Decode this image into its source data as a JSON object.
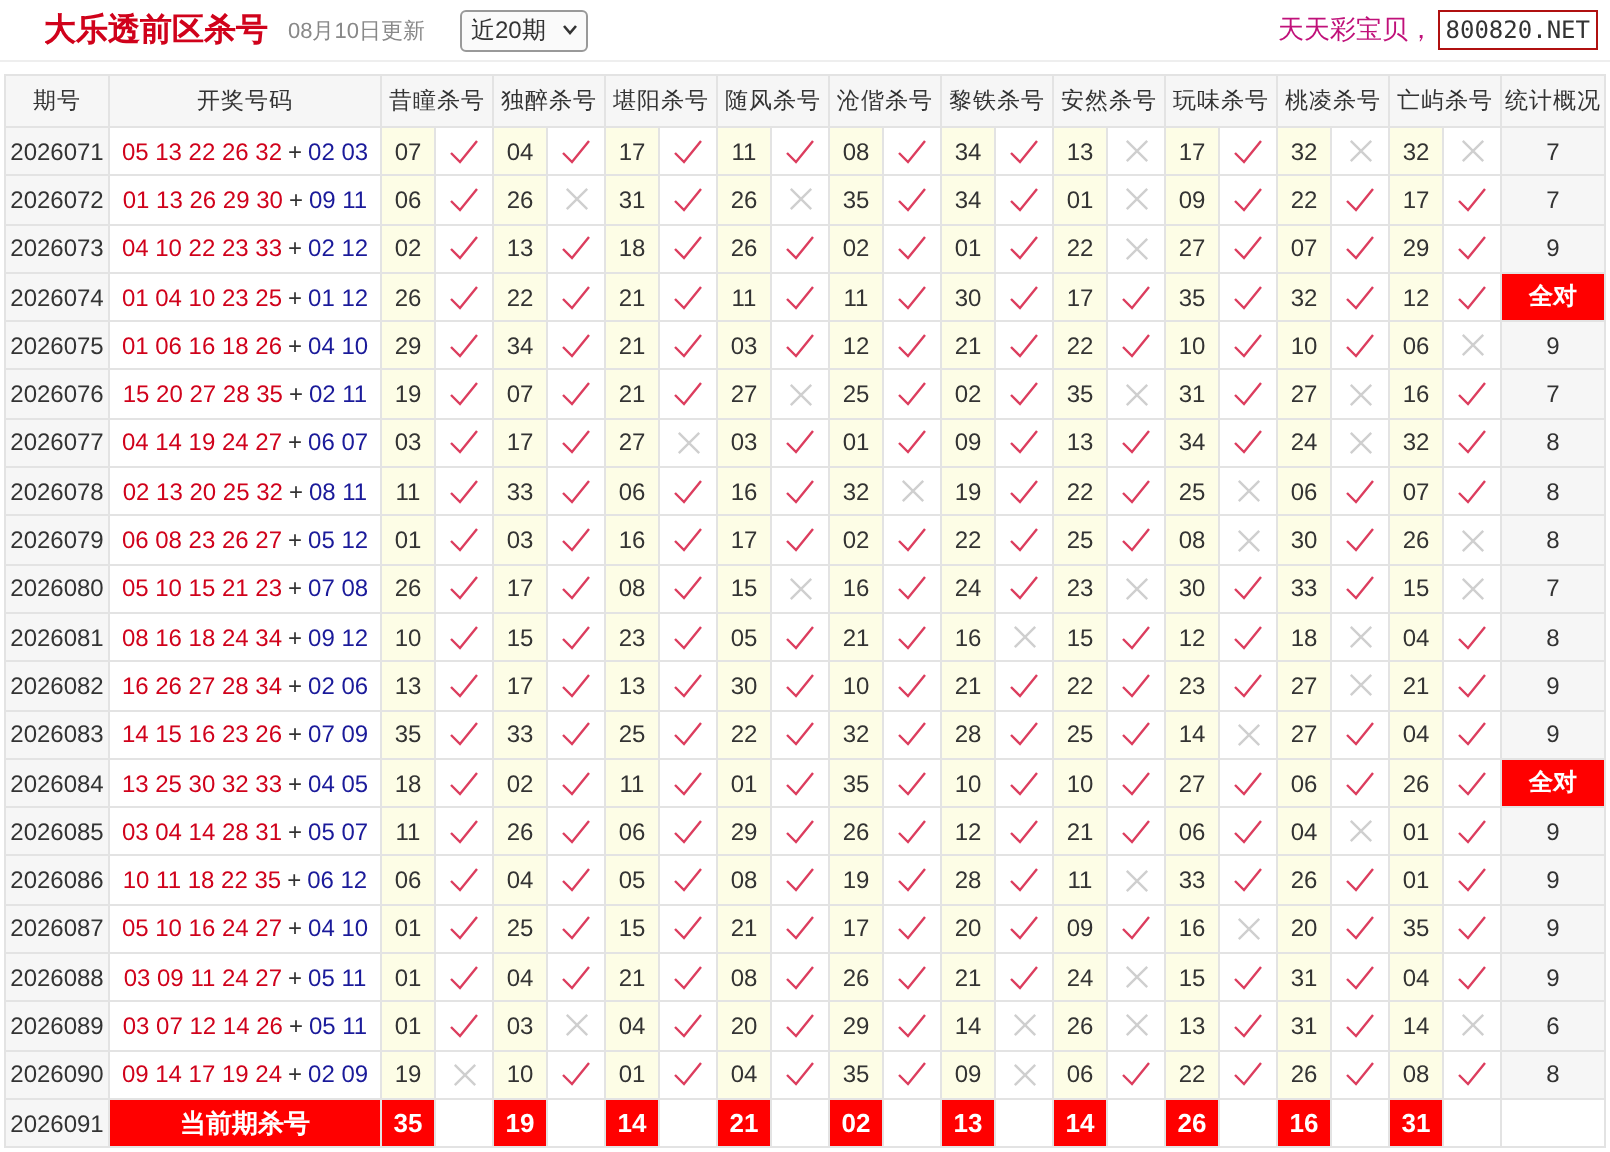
{
  "header": {
    "title": "大乐透前区杀号",
    "updated": "08月10日更新",
    "period_select": {
      "value": "近20期"
    },
    "slogan": "天天彩宝贝，",
    "site_badge": "800820.NET"
  },
  "table": {
    "columns": [
      "期号",
      "开奖号码",
      "昔瞳杀号",
      "独醉杀号",
      "堪阳杀号",
      "随风杀号",
      "沧偕杀号",
      "黎铁杀号",
      "安然杀号",
      "玩味杀号",
      "桃凌杀号",
      "亡屿杀号",
      "统计概况"
    ],
    "rows": [
      {
        "period": "2026071",
        "front": "05 13 22 26 32",
        "plus": "+",
        "back": "02 03",
        "kills": [
          {
            "number": "07",
            "hit": true
          },
          {
            "number": "04",
            "hit": true
          },
          {
            "number": "17",
            "hit": true
          },
          {
            "number": "11",
            "hit": true
          },
          {
            "number": "08",
            "hit": true
          },
          {
            "number": "34",
            "hit": true
          },
          {
            "number": "13",
            "hit": false
          },
          {
            "number": "17",
            "hit": true
          },
          {
            "number": "32",
            "hit": false
          },
          {
            "number": "32",
            "hit": false
          }
        ],
        "stat": {
          "text": "7",
          "all_correct": false
        }
      },
      {
        "period": "2026072",
        "front": "01 13 26 29 30",
        "plus": "+",
        "back": "09 11",
        "kills": [
          {
            "number": "06",
            "hit": true
          },
          {
            "number": "26",
            "hit": false
          },
          {
            "number": "31",
            "hit": true
          },
          {
            "number": "26",
            "hit": false
          },
          {
            "number": "35",
            "hit": true
          },
          {
            "number": "34",
            "hit": true
          },
          {
            "number": "01",
            "hit": false
          },
          {
            "number": "09",
            "hit": true
          },
          {
            "number": "22",
            "hit": true
          },
          {
            "number": "17",
            "hit": true
          }
        ],
        "stat": {
          "text": "7",
          "all_correct": false
        }
      },
      {
        "period": "2026073",
        "front": "04 10 22 23 33",
        "plus": "+",
        "back": "02 12",
        "kills": [
          {
            "number": "02",
            "hit": true
          },
          {
            "number": "13",
            "hit": true
          },
          {
            "number": "18",
            "hit": true
          },
          {
            "number": "26",
            "hit": true
          },
          {
            "number": "02",
            "hit": true
          },
          {
            "number": "01",
            "hit": true
          },
          {
            "number": "22",
            "hit": false
          },
          {
            "number": "27",
            "hit": true
          },
          {
            "number": "07",
            "hit": true
          },
          {
            "number": "29",
            "hit": true
          }
        ],
        "stat": {
          "text": "9",
          "all_correct": false
        }
      },
      {
        "period": "2026074",
        "front": "01 04 10 23 25",
        "plus": "+",
        "back": "01 12",
        "kills": [
          {
            "number": "26",
            "hit": true
          },
          {
            "number": "22",
            "hit": true
          },
          {
            "number": "21",
            "hit": true
          },
          {
            "number": "11",
            "hit": true
          },
          {
            "number": "11",
            "hit": true
          },
          {
            "number": "30",
            "hit": true
          },
          {
            "number": "17",
            "hit": true
          },
          {
            "number": "35",
            "hit": true
          },
          {
            "number": "32",
            "hit": true
          },
          {
            "number": "12",
            "hit": true
          }
        ],
        "stat": {
          "text": "全对",
          "all_correct": true
        }
      },
      {
        "period": "2026075",
        "front": "01 06 16 18 26",
        "plus": "+",
        "back": "04 10",
        "kills": [
          {
            "number": "29",
            "hit": true
          },
          {
            "number": "34",
            "hit": true
          },
          {
            "number": "21",
            "hit": true
          },
          {
            "number": "03",
            "hit": true
          },
          {
            "number": "12",
            "hit": true
          },
          {
            "number": "21",
            "hit": true
          },
          {
            "number": "22",
            "hit": true
          },
          {
            "number": "10",
            "hit": true
          },
          {
            "number": "10",
            "hit": true
          },
          {
            "number": "06",
            "hit": false
          }
        ],
        "stat": {
          "text": "9",
          "all_correct": false
        }
      },
      {
        "period": "2026076",
        "front": "15 20 27 28 35",
        "plus": "+",
        "back": "02 11",
        "kills": [
          {
            "number": "19",
            "hit": true
          },
          {
            "number": "07",
            "hit": true
          },
          {
            "number": "21",
            "hit": true
          },
          {
            "number": "27",
            "hit": false
          },
          {
            "number": "25",
            "hit": true
          },
          {
            "number": "02",
            "hit": true
          },
          {
            "number": "35",
            "hit": false
          },
          {
            "number": "31",
            "hit": true
          },
          {
            "number": "27",
            "hit": false
          },
          {
            "number": "16",
            "hit": true
          }
        ],
        "stat": {
          "text": "7",
          "all_correct": false
        }
      },
      {
        "period": "2026077",
        "front": "04 14 19 24 27",
        "plus": "+",
        "back": "06 07",
        "kills": [
          {
            "number": "03",
            "hit": true
          },
          {
            "number": "17",
            "hit": true
          },
          {
            "number": "27",
            "hit": false
          },
          {
            "number": "03",
            "hit": true
          },
          {
            "number": "01",
            "hit": true
          },
          {
            "number": "09",
            "hit": true
          },
          {
            "number": "13",
            "hit": true
          },
          {
            "number": "34",
            "hit": true
          },
          {
            "number": "24",
            "hit": false
          },
          {
            "number": "32",
            "hit": true
          }
        ],
        "stat": {
          "text": "8",
          "all_correct": false
        }
      },
      {
        "period": "2026078",
        "front": "02 13 20 25 32",
        "plus": "+",
        "back": "08 11",
        "kills": [
          {
            "number": "11",
            "hit": true
          },
          {
            "number": "33",
            "hit": true
          },
          {
            "number": "06",
            "hit": true
          },
          {
            "number": "16",
            "hit": true
          },
          {
            "number": "32",
            "hit": false
          },
          {
            "number": "19",
            "hit": true
          },
          {
            "number": "22",
            "hit": true
          },
          {
            "number": "25",
            "hit": false
          },
          {
            "number": "06",
            "hit": true
          },
          {
            "number": "07",
            "hit": true
          }
        ],
        "stat": {
          "text": "8",
          "all_correct": false
        }
      },
      {
        "period": "2026079",
        "front": "06 08 23 26 27",
        "plus": "+",
        "back": "05 12",
        "kills": [
          {
            "number": "01",
            "hit": true
          },
          {
            "number": "03",
            "hit": true
          },
          {
            "number": "16",
            "hit": true
          },
          {
            "number": "17",
            "hit": true
          },
          {
            "number": "02",
            "hit": true
          },
          {
            "number": "22",
            "hit": true
          },
          {
            "number": "25",
            "hit": true
          },
          {
            "number": "08",
            "hit": false
          },
          {
            "number": "30",
            "hit": true
          },
          {
            "number": "26",
            "hit": false
          }
        ],
        "stat": {
          "text": "8",
          "all_correct": false
        }
      },
      {
        "period": "2026080",
        "front": "05 10 15 21 23",
        "plus": "+",
        "back": "07 08",
        "kills": [
          {
            "number": "26",
            "hit": true
          },
          {
            "number": "17",
            "hit": true
          },
          {
            "number": "08",
            "hit": true
          },
          {
            "number": "15",
            "hit": false
          },
          {
            "number": "16",
            "hit": true
          },
          {
            "number": "24",
            "hit": true
          },
          {
            "number": "23",
            "hit": false
          },
          {
            "number": "30",
            "hit": true
          },
          {
            "number": "33",
            "hit": true
          },
          {
            "number": "15",
            "hit": false
          }
        ],
        "stat": {
          "text": "7",
          "all_correct": false
        }
      },
      {
        "period": "2026081",
        "front": "08 16 18 24 34",
        "plus": "+",
        "back": "09 12",
        "kills": [
          {
            "number": "10",
            "hit": true
          },
          {
            "number": "15",
            "hit": true
          },
          {
            "number": "23",
            "hit": true
          },
          {
            "number": "05",
            "hit": true
          },
          {
            "number": "21",
            "hit": true
          },
          {
            "number": "16",
            "hit": false
          },
          {
            "number": "15",
            "hit": true
          },
          {
            "number": "12",
            "hit": true
          },
          {
            "number": "18",
            "hit": false
          },
          {
            "number": "04",
            "hit": true
          }
        ],
        "stat": {
          "text": "8",
          "all_correct": false
        }
      },
      {
        "period": "2026082",
        "front": "16 26 27 28 34",
        "plus": "+",
        "back": "02 06",
        "kills": [
          {
            "number": "13",
            "hit": true
          },
          {
            "number": "17",
            "hit": true
          },
          {
            "number": "13",
            "hit": true
          },
          {
            "number": "30",
            "hit": true
          },
          {
            "number": "10",
            "hit": true
          },
          {
            "number": "21",
            "hit": true
          },
          {
            "number": "22",
            "hit": true
          },
          {
            "number": "23",
            "hit": true
          },
          {
            "number": "27",
            "hit": false
          },
          {
            "number": "21",
            "hit": true
          }
        ],
        "stat": {
          "text": "9",
          "all_correct": false
        }
      },
      {
        "period": "2026083",
        "front": "14 15 16 23 26",
        "plus": "+",
        "back": "07 09",
        "kills": [
          {
            "number": "35",
            "hit": true
          },
          {
            "number": "33",
            "hit": true
          },
          {
            "number": "25",
            "hit": true
          },
          {
            "number": "22",
            "hit": true
          },
          {
            "number": "32",
            "hit": true
          },
          {
            "number": "28",
            "hit": true
          },
          {
            "number": "25",
            "hit": true
          },
          {
            "number": "14",
            "hit": false
          },
          {
            "number": "27",
            "hit": true
          },
          {
            "number": "04",
            "hit": true
          }
        ],
        "stat": {
          "text": "9",
          "all_correct": false
        }
      },
      {
        "period": "2026084",
        "front": "13 25 30 32 33",
        "plus": "+",
        "back": "04 05",
        "kills": [
          {
            "number": "18",
            "hit": true
          },
          {
            "number": "02",
            "hit": true
          },
          {
            "number": "11",
            "hit": true
          },
          {
            "number": "01",
            "hit": true
          },
          {
            "number": "35",
            "hit": true
          },
          {
            "number": "10",
            "hit": true
          },
          {
            "number": "10",
            "hit": true
          },
          {
            "number": "27",
            "hit": true
          },
          {
            "number": "06",
            "hit": true
          },
          {
            "number": "26",
            "hit": true
          }
        ],
        "stat": {
          "text": "全对",
          "all_correct": true
        }
      },
      {
        "period": "2026085",
        "front": "03 04 14 28 31",
        "plus": "+",
        "back": "05 07",
        "kills": [
          {
            "number": "11",
            "hit": true
          },
          {
            "number": "26",
            "hit": true
          },
          {
            "number": "06",
            "hit": true
          },
          {
            "number": "29",
            "hit": true
          },
          {
            "number": "26",
            "hit": true
          },
          {
            "number": "12",
            "hit": true
          },
          {
            "number": "21",
            "hit": true
          },
          {
            "number": "06",
            "hit": true
          },
          {
            "number": "04",
            "hit": false
          },
          {
            "number": "01",
            "hit": true
          }
        ],
        "stat": {
          "text": "9",
          "all_correct": false
        }
      },
      {
        "period": "2026086",
        "front": "10 11 18 22 35",
        "plus": "+",
        "back": "06 12",
        "kills": [
          {
            "number": "06",
            "hit": true
          },
          {
            "number": "04",
            "hit": true
          },
          {
            "number": "05",
            "hit": true
          },
          {
            "number": "08",
            "hit": true
          },
          {
            "number": "19",
            "hit": true
          },
          {
            "number": "28",
            "hit": true
          },
          {
            "number": "11",
            "hit": false
          },
          {
            "number": "33",
            "hit": true
          },
          {
            "number": "26",
            "hit": true
          },
          {
            "number": "01",
            "hit": true
          }
        ],
        "stat": {
          "text": "9",
          "all_correct": false
        }
      },
      {
        "period": "2026087",
        "front": "05 10 16 24 27",
        "plus": "+",
        "back": "04 10",
        "kills": [
          {
            "number": "01",
            "hit": true
          },
          {
            "number": "25",
            "hit": true
          },
          {
            "number": "15",
            "hit": true
          },
          {
            "number": "21",
            "hit": true
          },
          {
            "number": "17",
            "hit": true
          },
          {
            "number": "20",
            "hit": true
          },
          {
            "number": "09",
            "hit": true
          },
          {
            "number": "16",
            "hit": false
          },
          {
            "number": "20",
            "hit": true
          },
          {
            "number": "35",
            "hit": true
          }
        ],
        "stat": {
          "text": "9",
          "all_correct": false
        }
      },
      {
        "period": "2026088",
        "front": "03 09 11 24 27",
        "plus": "+",
        "back": "05 11",
        "kills": [
          {
            "number": "01",
            "hit": true
          },
          {
            "number": "04",
            "hit": true
          },
          {
            "number": "21",
            "hit": true
          },
          {
            "number": "08",
            "hit": true
          },
          {
            "number": "26",
            "hit": true
          },
          {
            "number": "21",
            "hit": true
          },
          {
            "number": "24",
            "hit": false
          },
          {
            "number": "15",
            "hit": true
          },
          {
            "number": "31",
            "hit": true
          },
          {
            "number": "04",
            "hit": true
          }
        ],
        "stat": {
          "text": "9",
          "all_correct": false
        }
      },
      {
        "period": "2026089",
        "front": "03 07 12 14 26",
        "plus": "+",
        "back": "05 11",
        "kills": [
          {
            "number": "01",
            "hit": true
          },
          {
            "number": "03",
            "hit": false
          },
          {
            "number": "04",
            "hit": true
          },
          {
            "number": "20",
            "hit": true
          },
          {
            "number": "29",
            "hit": true
          },
          {
            "number": "14",
            "hit": false
          },
          {
            "number": "26",
            "hit": false
          },
          {
            "number": "13",
            "hit": true
          },
          {
            "number": "31",
            "hit": true
          },
          {
            "number": "14",
            "hit": false
          }
        ],
        "stat": {
          "text": "6",
          "all_correct": false
        }
      },
      {
        "period": "2026090",
        "front": "09 14 17 19 24",
        "plus": "+",
        "back": "02 09",
        "kills": [
          {
            "number": "19",
            "hit": false
          },
          {
            "number": "10",
            "hit": true
          },
          {
            "number": "01",
            "hit": true
          },
          {
            "number": "04",
            "hit": true
          },
          {
            "number": "35",
            "hit": true
          },
          {
            "number": "09",
            "hit": false
          },
          {
            "number": "06",
            "hit": true
          },
          {
            "number": "22",
            "hit": true
          },
          {
            "number": "26",
            "hit": true
          },
          {
            "number": "08",
            "hit": true
          }
        ],
        "stat": {
          "text": "8",
          "all_correct": false
        }
      }
    ],
    "current": {
      "period": "2026091",
      "label": "当前期杀号",
      "kills": [
        "35",
        "19",
        "14",
        "21",
        "02",
        "13",
        "14",
        "26",
        "16",
        "31"
      ]
    }
  }
}
